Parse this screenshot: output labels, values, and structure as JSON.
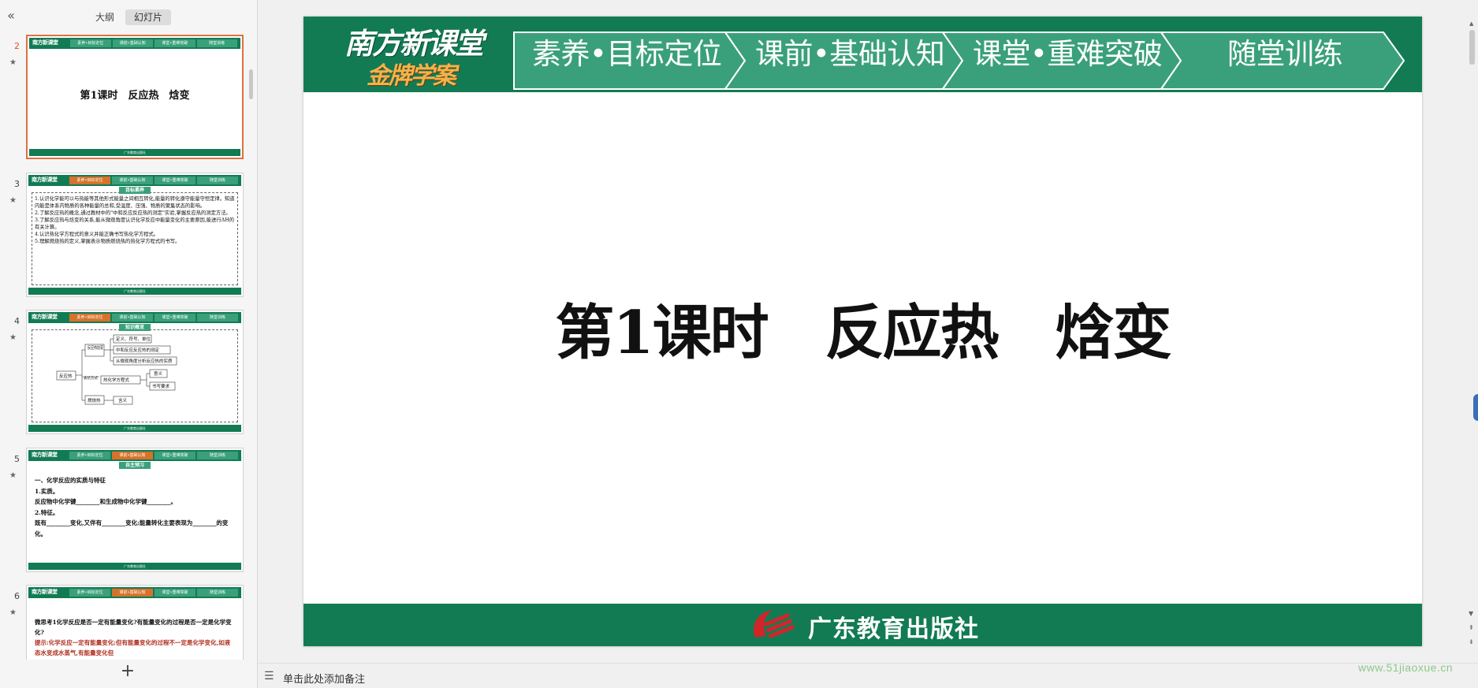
{
  "panel": {
    "collapse_icon": "«",
    "tabs": [
      "大纲",
      "幻灯片"
    ],
    "add_icon": "+"
  },
  "thumbs": [
    {
      "num": "2",
      "title": "第1课时　反应热　焓变"
    },
    {
      "num": "3",
      "badge": "目标素养",
      "lines": [
        "1.认识化学能可以与热能等其他形式能量之间相互转化,能量的转化遵守能量守恒定律。知道内能是体系内物质的各种能量的总和,受温度、压强、物质的聚集状态的影响。",
        "2.了解反应热的概念,通过教材中的\"中和反应反应热的测定\"实验,掌握反应热的测定方法。",
        "3.了解反应热与焓变的关系,能从微观角度认识化学反应中能量变化的主要原因,能进行ΔH的有关计算。",
        "4.认识热化学方程式的意义并能正确书写热化学方程式。",
        "5.理解燃烧热的定义,掌握表示物质燃烧热的热化学方程式的书写。"
      ]
    },
    {
      "num": "4",
      "badge": "知识概览",
      "nodes": [
        "反应热",
        "反应热焓变",
        "表达方式",
        "燃烧热",
        "定义、符号、单位",
        "中和反应反应热的测定",
        "从微观角度分析反应热的实质",
        "热化学方程式",
        "意义",
        "书写要求",
        "含义"
      ]
    },
    {
      "num": "5",
      "badge": "自主预习",
      "lines": [
        "一、化学反应的实质与特征",
        "1.实质。",
        "反应物中化学键________和生成物中化学键________。",
        "2.特征。",
        "既有________变化,又伴有________变化;能量转化主要表现为________的变化。"
      ]
    },
    {
      "num": "6",
      "lines": [
        "微思考1化学反应是否一定有能量变化?有能量变化的过程是否一定是化学变化?",
        "提示:化学反应一定有能量变化;但有能量变化的过程不一定是化学变化,如液态水变成水蒸气,有能量变化但"
      ]
    }
  ],
  "thumb_tabs": [
    "素养•目标定位",
    "课前•基础认知",
    "课堂•重难突破",
    "随堂训练"
  ],
  "thumb_footer": "广东教育出版社",
  "slide": {
    "brand_line1": "南方新课堂",
    "brand_line2": "金牌学案",
    "nav": [
      "素养•目标定位",
      "课前•基础认知",
      "课堂•重难突破",
      "随堂训练"
    ],
    "title": "第1课时　反应热　焓变",
    "publisher": "广东教育出版社"
  },
  "notes": {
    "placeholder": "单击此处添加备注"
  },
  "watermark": "www.51jiaoxue.cn",
  "colors": {
    "brand_green": "#127b54",
    "tab_green": "#3aa07b",
    "accent_orange": "#e0561b",
    "gold": "#f4b24a"
  }
}
